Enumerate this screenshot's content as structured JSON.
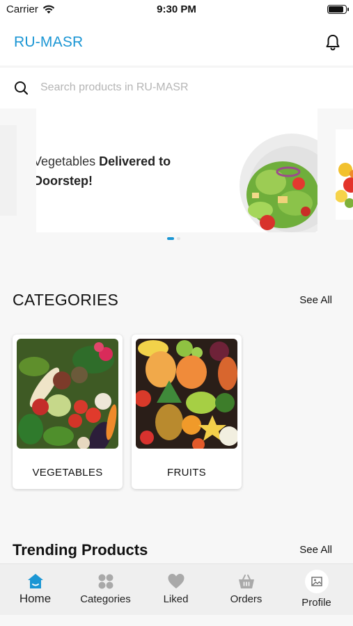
{
  "status_bar": {
    "carrier": "Carrier",
    "time": "9:30 PM",
    "battery_level": 0.9
  },
  "header": {
    "title": "RU-MASR",
    "notification_icon": "bell-icon"
  },
  "search": {
    "placeholder": "Search products in RU-MASR",
    "value": ""
  },
  "carousel": {
    "slide_text_normal": "Vegetables ",
    "slide_text_bold": "Delivered to",
    "slide_text_line2": "Doorstep!",
    "active_index": 0,
    "slide_count": 2
  },
  "categories": {
    "title": "CATEGORIES",
    "see_all": "See All",
    "items": [
      {
        "label": "VEGETABLES"
      },
      {
        "label": "FRUITS"
      }
    ]
  },
  "trending": {
    "title": "Trending Products",
    "see_all": "See All"
  },
  "bottom_nav": {
    "active": "Home",
    "accent_color": "#1b96d4",
    "items": [
      {
        "label": "Home",
        "icon": "home-icon"
      },
      {
        "label": "Categories",
        "icon": "grid-icon"
      },
      {
        "label": "Liked",
        "icon": "heart-icon"
      },
      {
        "label": "Orders",
        "icon": "basket-icon"
      },
      {
        "label": "Profile",
        "icon": "image-icon"
      }
    ]
  }
}
